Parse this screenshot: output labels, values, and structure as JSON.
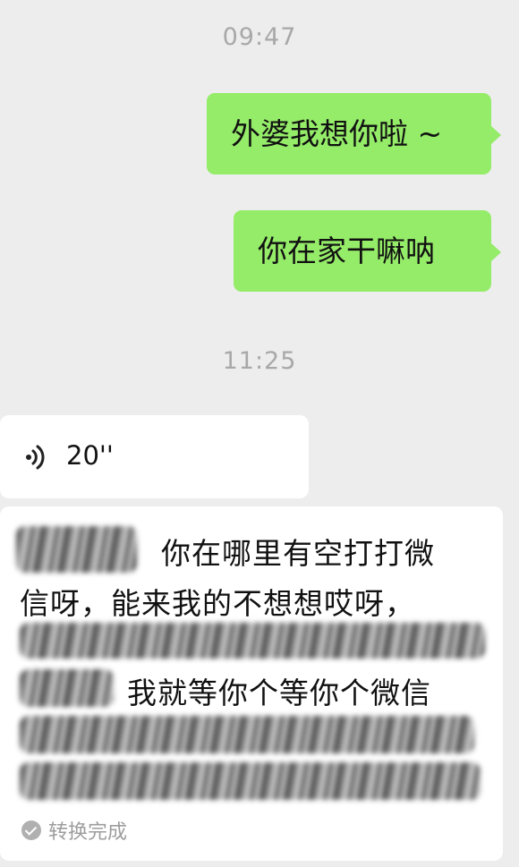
{
  "timestamps": [
    "09:47",
    "11:25"
  ],
  "messages_sent": [
    {
      "text": "外婆我想你啦 ~"
    },
    {
      "text": "你在家干嘛呐"
    }
  ],
  "voice_message": {
    "icon": "voice-wave-icon",
    "duration": "20''"
  },
  "transcript": {
    "line1": "你在哪里有空打打微",
    "line2": "信呀，能来我的不想想哎呀，",
    "line3": "我就等你个等你个微信",
    "status": "转换完成"
  },
  "colors": {
    "background": "#ededed",
    "sent_bubble": "#95ec69",
    "received_bubble": "#ffffff",
    "timestamp": "#a8a8a8"
  }
}
